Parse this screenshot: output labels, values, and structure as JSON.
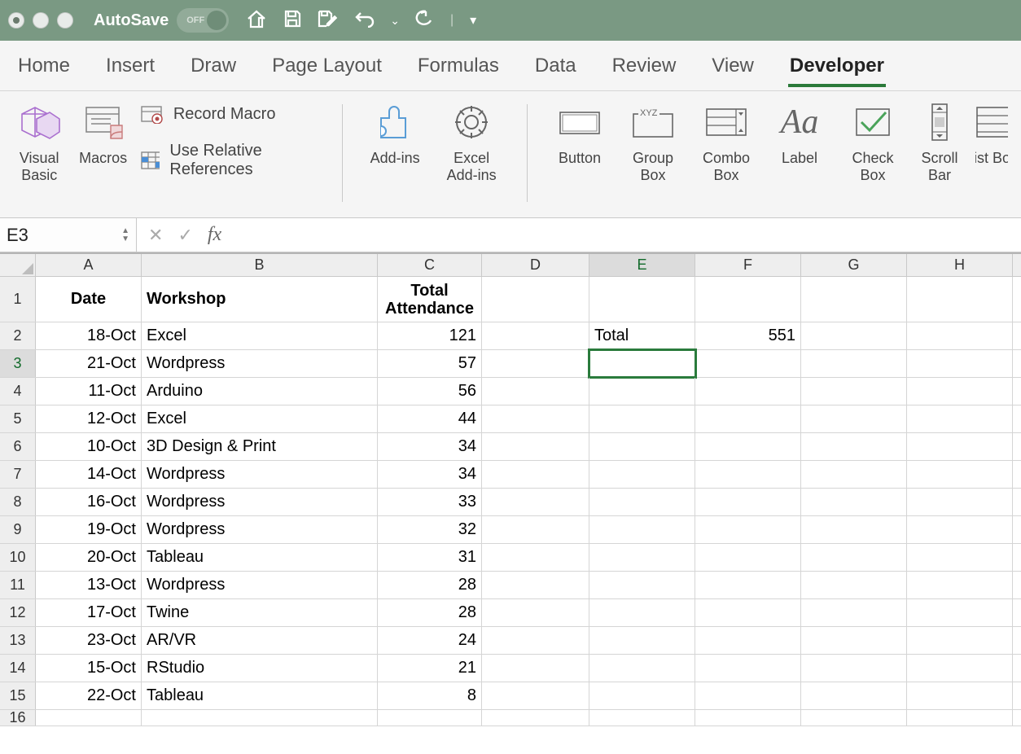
{
  "titlebar": {
    "autosave_label": "AutoSave",
    "toggle_text": "OFF"
  },
  "tabs": [
    "Home",
    "Insert",
    "Draw",
    "Page Layout",
    "Formulas",
    "Data",
    "Review",
    "View",
    "Developer"
  ],
  "active_tab_index": 8,
  "ribbon": {
    "visual_basic": "Visual Basic",
    "macros": "Macros",
    "record_macro": "Record Macro",
    "use_relative": "Use Relative References",
    "addins": "Add-ins",
    "excel_addins": "Excel Add-ins",
    "button": "Button",
    "group_box": "Group Box",
    "combo_box": "Combo Box",
    "label": "Label",
    "check_box": "Check Box",
    "scroll_bar": "Scroll Bar",
    "list_box": "List Box"
  },
  "namebox": "E3",
  "formula": "",
  "columns": [
    "A",
    "B",
    "C",
    "D",
    "E",
    "F",
    "G",
    "H"
  ],
  "headers": {
    "A": "Date",
    "B": "Workshop",
    "C": "Total Attendance"
  },
  "summary": {
    "label": "Total",
    "value": "551"
  },
  "data": [
    {
      "date": "18-Oct",
      "workshop": "Excel",
      "att": "121"
    },
    {
      "date": "21-Oct",
      "workshop": "Wordpress",
      "att": "57"
    },
    {
      "date": "11-Oct",
      "workshop": "Arduino",
      "att": "56"
    },
    {
      "date": "12-Oct",
      "workshop": "Excel",
      "att": "44"
    },
    {
      "date": "10-Oct",
      "workshop": "3D Design & Print",
      "att": "34"
    },
    {
      "date": "14-Oct",
      "workshop": "Wordpress",
      "att": "34"
    },
    {
      "date": "16-Oct",
      "workshop": "Wordpress",
      "att": "33"
    },
    {
      "date": "19-Oct",
      "workshop": "Wordpress",
      "att": "32"
    },
    {
      "date": "20-Oct",
      "workshop": "Tableau",
      "att": "31"
    },
    {
      "date": "13-Oct",
      "workshop": "Wordpress",
      "att": "28"
    },
    {
      "date": "17-Oct",
      "workshop": "Twine",
      "att": "28"
    },
    {
      "date": "23-Oct",
      "workshop": "AR/VR",
      "att": "24"
    },
    {
      "date": "15-Oct",
      "workshop": "RStudio",
      "att": "21"
    },
    {
      "date": "22-Oct",
      "workshop": "Tableau",
      "att": "8"
    }
  ],
  "selected_cell": "E3"
}
